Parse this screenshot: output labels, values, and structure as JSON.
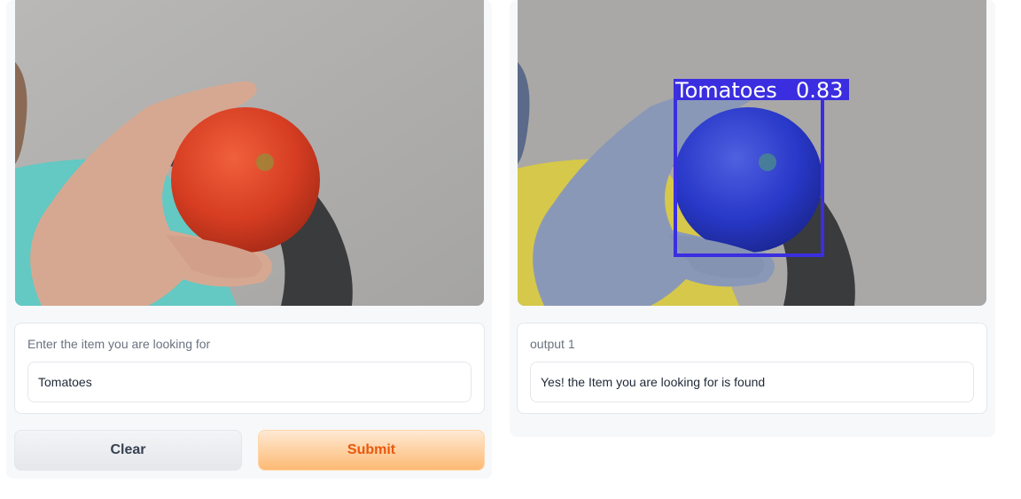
{
  "input_panel": {
    "image": {
      "name": "input-webcam-image",
      "scene": "hand holding a tomato",
      "subject_color": "#d9442a"
    },
    "textbox": {
      "label": "Enter the item you are looking for",
      "value": "Tomatoes"
    },
    "buttons": {
      "clear_label": "Clear",
      "submit_label": "Submit"
    }
  },
  "output_panel": {
    "image": {
      "name": "output-detection-image",
      "detection": {
        "label": "Tomatoes",
        "confidence": "0.83",
        "box_color": "#3b2ee0"
      }
    },
    "textbox": {
      "label": "output 1",
      "value": "Yes! the Item you are looking for is found"
    }
  },
  "colors": {
    "panel_bg": "#f7f8fa",
    "submit_text": "#ea580c",
    "submit_gradient_end": "#fdba74"
  }
}
